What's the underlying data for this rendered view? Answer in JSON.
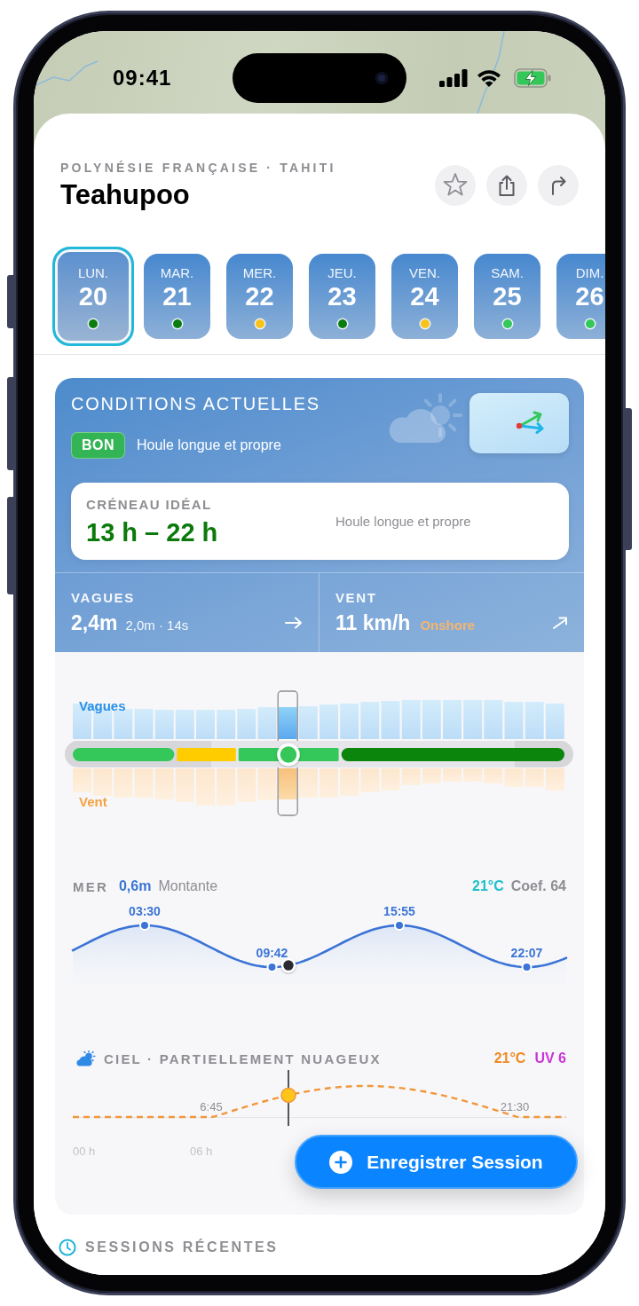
{
  "status_bar": {
    "time": "09:41"
  },
  "header": {
    "region": "POLYNÉSIE FRANÇAISE · TAHITI",
    "title": "Teahupoo",
    "actions": [
      {
        "kind": "star"
      },
      {
        "kind": "share"
      },
      {
        "kind": "directions"
      }
    ]
  },
  "days": [
    {
      "day": "LUN.",
      "date": "20",
      "selected": true,
      "color": "#0b7d10"
    },
    {
      "day": "MAR.",
      "date": "21",
      "selected": false,
      "color": "#0b7d10"
    },
    {
      "day": "MER.",
      "date": "22",
      "selected": false,
      "color": "#f7c31a"
    },
    {
      "day": "JEU.",
      "date": "23",
      "selected": false,
      "color": "#0b7d10"
    },
    {
      "day": "VEN.",
      "date": "24",
      "selected": false,
      "color": "#f7c31a"
    },
    {
      "day": "SAM.",
      "date": "25",
      "selected": false,
      "color": "#34c759"
    },
    {
      "day": "DIM.",
      "date": "26",
      "selected": false,
      "color": "#34c759"
    }
  ],
  "conditions": {
    "title": "CONDITIONS ACTUELLES",
    "rating": "BON",
    "summary": "Houle longue et propre",
    "ideal_window": {
      "label": "CRÉNEAU IDÉAL",
      "hours": "13 h – 22 h",
      "note": "Houle longue et propre"
    },
    "stats": [
      {
        "kind": "waves",
        "label": "VAGUES",
        "value": "2,4m",
        "detail": "2,0m · 14s"
      },
      {
        "kind": "wind",
        "label": "VENT",
        "value": "11 km/h",
        "detail": "Onshore"
      }
    ]
  },
  "forecast": {
    "wave_label": "Vagues",
    "wind_label": "Vent",
    "timeline": {
      "level": 0.437
    }
  },
  "tide": {
    "label": "MER",
    "height": "0,6m",
    "trend": "Montante",
    "water_temperature": "21°C",
    "coefficient": "Coef. 64",
    "extremes": [
      {
        "kind": "high",
        "time": "03:30"
      },
      {
        "kind": "low",
        "time": "09:42"
      },
      {
        "kind": "high",
        "time": "15:55"
      },
      {
        "kind": "low",
        "time": "22:07"
      }
    ]
  },
  "sky": {
    "label": "CIEL · PARTIELLEMENT NUAGEUX",
    "air_temperature": "21°C",
    "uv": "UV 6",
    "sunrise": "6:45",
    "sunset": "21:30",
    "hours": [
      "00 h",
      "06 h"
    ]
  },
  "record_button": {
    "label": "Enregistrer Session"
  },
  "recent_sessions": {
    "title": "SESSIONS RÉCENTES"
  }
}
